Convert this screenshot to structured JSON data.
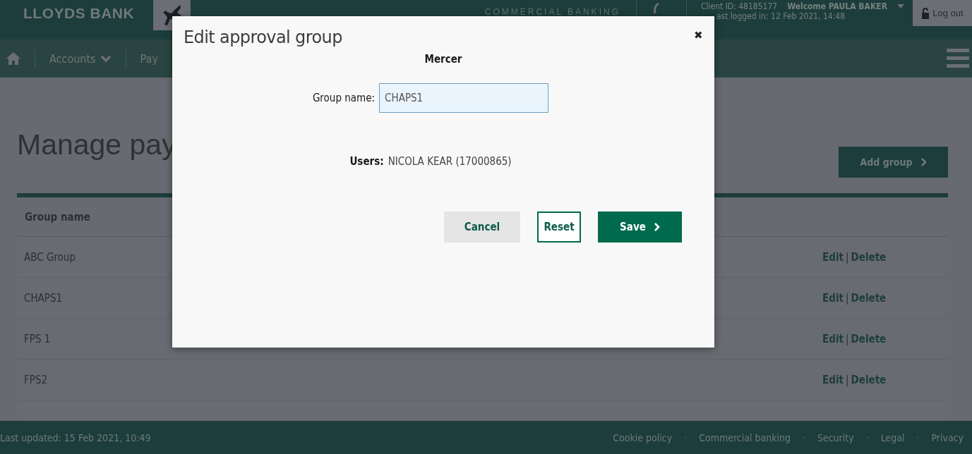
{
  "header": {
    "logo": "LLOYDS BANK",
    "segment": "COMMERCIAL BANKING",
    "client_id": "Client ID: 48185177",
    "welcome": "Welcome PAULA BAKER",
    "last_logged": "ast logged in: 12 Feb 2021, 14:48",
    "logout": "Log out"
  },
  "nav": {
    "items": [
      {
        "label": "Accounts",
        "dropdown": true
      },
      {
        "label": "Pay",
        "dropdown": false
      }
    ]
  },
  "page": {
    "title": "Manage pay",
    "add_button": "Add group"
  },
  "table": {
    "columns": [
      "Group name"
    ],
    "rows": [
      {
        "name": "ABC Group",
        "edit": "Edit",
        "separator": "|",
        "delete": "Delete"
      },
      {
        "name": "CHAPS1",
        "edit": "Edit",
        "separator": "|",
        "delete": "Delete"
      },
      {
        "name": "FPS 1",
        "edit": "Edit",
        "separator": "|",
        "delete": "Delete"
      },
      {
        "name": "FPS2",
        "edit": "Edit",
        "separator": "|",
        "delete": "Delete"
      }
    ]
  },
  "footer": {
    "last_updated": "Last updated: 15 Feb 2021, 10:49",
    "links": [
      "Cookie policy",
      "Commercial banking",
      "Security",
      "Legal",
      "Privacy"
    ]
  },
  "modal": {
    "title": "Edit approval group",
    "close": "✖",
    "company": "Mercer",
    "field_label": "Group name:",
    "field_value": "CHAPS1",
    "users_label": "Users:",
    "users_value": "NICOLA KEAR (17000865)",
    "buttons": [
      {
        "label": "Cancel",
        "kind": "secondary"
      },
      {
        "label": "Reset",
        "kind": "outline"
      },
      {
        "label": "Save",
        "kind": "primary"
      }
    ]
  }
}
